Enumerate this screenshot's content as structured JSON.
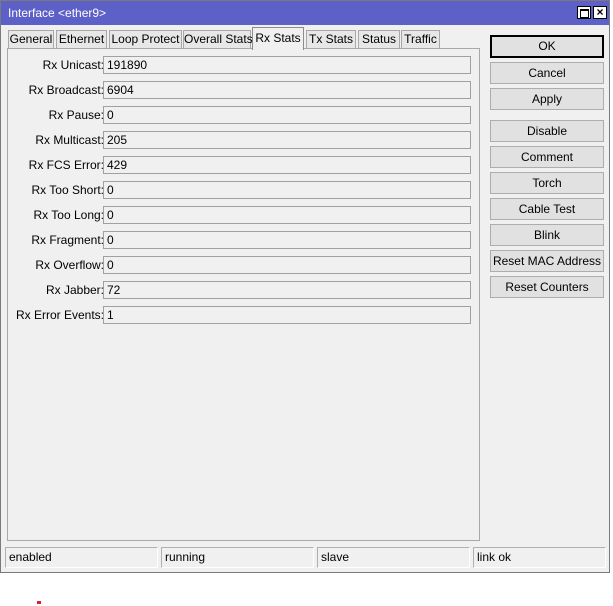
{
  "window": {
    "title": "Interface <ether9>"
  },
  "tabs": [
    {
      "label": "General"
    },
    {
      "label": "Ethernet"
    },
    {
      "label": "Loop Protect"
    },
    {
      "label": "Overall Stats"
    },
    {
      "label": "Rx Stats",
      "active": true
    },
    {
      "label": "Tx Stats"
    },
    {
      "label": "Status"
    },
    {
      "label": "Traffic"
    }
  ],
  "fields": [
    {
      "label": "Rx Unicast:",
      "value": "191890"
    },
    {
      "label": "Rx Broadcast:",
      "value": "6904"
    },
    {
      "label": "Rx Pause:",
      "value": "0"
    },
    {
      "label": "Rx Multicast:",
      "value": "205"
    },
    {
      "label": "Rx FCS Error:",
      "value": "429"
    },
    {
      "label": "Rx Too Short:",
      "value": "0"
    },
    {
      "label": "Rx Too Long:",
      "value": "0"
    },
    {
      "label": "Rx Fragment:",
      "value": "0"
    },
    {
      "label": "Rx Overflow:",
      "value": "0"
    },
    {
      "label": "Rx Jabber:",
      "value": "72"
    },
    {
      "label": "Rx Error Events:",
      "value": "1"
    }
  ],
  "buttons": {
    "ok": "OK",
    "cancel": "Cancel",
    "apply": "Apply",
    "disable": "Disable",
    "comment": "Comment",
    "torch": "Torch",
    "cable_test": "Cable Test",
    "blink": "Blink",
    "reset_mac": "Reset MAC Address",
    "reset_counters": "Reset Counters"
  },
  "status": [
    "enabled",
    "running",
    "slave",
    "link ok"
  ],
  "icons": {
    "maximize": "maximize-icon",
    "close": "close-icon"
  },
  "colors": {
    "titlebar": "#5d60c6"
  }
}
